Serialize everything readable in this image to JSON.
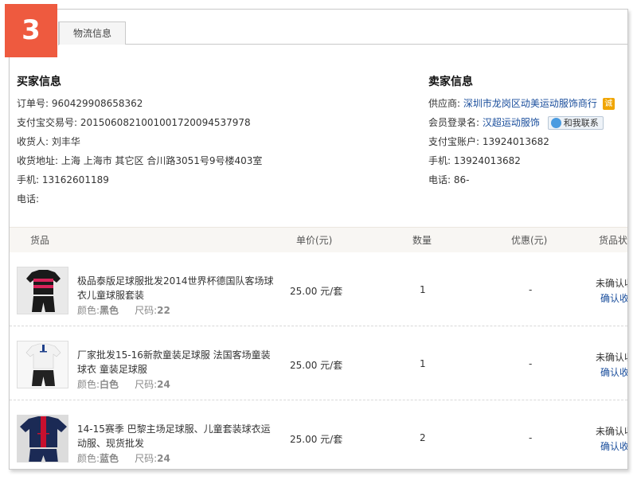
{
  "step_badge": "3",
  "tabs": [
    {
      "label": "物流信息"
    }
  ],
  "buyer": {
    "title": "买家信息",
    "rows": [
      {
        "label": "订单号:",
        "value": "960429908658362"
      },
      {
        "label": "支付宝交易号:",
        "value": "2015060821001001720094537978"
      },
      {
        "label": "收货人:",
        "value": "刘丰华"
      },
      {
        "label": "收货地址:",
        "value": "上海 上海市 其它区 合川路3051号9号楼403室"
      },
      {
        "label": "手机:",
        "value": "13162601189"
      },
      {
        "label": "电话:",
        "value": ""
      }
    ]
  },
  "seller": {
    "title": "卖家信息",
    "supplier_label": "供应商:",
    "supplier_name": "深圳市龙岗区动美运动服饰商行",
    "cheng_icon": "诚",
    "member_label": "会员登录名:",
    "member_name": "汉超运动服饰",
    "contact_button": "和我联系",
    "alipay_label": "支付宝账户:",
    "alipay_value": "13924013682",
    "mobile_label": "手机:",
    "mobile_value": "13924013682",
    "phone_label": "电话:",
    "phone_value": "86-"
  },
  "table": {
    "headers": {
      "goods": "货品",
      "price": "单价(元)",
      "qty": "数量",
      "discount": "优惠(元)",
      "status": "货品状"
    }
  },
  "items": [
    {
      "title": "极品泰版足球服批发2014世界杯德国队客场球衣儿童球服套装",
      "color_label": "颜色:",
      "color": "黑色",
      "size_label": "尺码:",
      "size": "22",
      "price": "25.00 元/套",
      "qty": "1",
      "discount": "-",
      "status": "未确认收",
      "action": "确认收",
      "shirt_color": "#1a1a1a",
      "stripe_color": "#d8235a",
      "shorts_color": "#1a1a1a"
    },
    {
      "title": "厂家批发15-16新款童装足球服 法国客场童装球衣 童装足球服",
      "color_label": "颜色:",
      "color": "白色",
      "size_label": "尺码:",
      "size": "24",
      "price": "25.00 元/套",
      "qty": "1",
      "discount": "-",
      "status": "未确认收",
      "action": "确认收",
      "shirt_color": "#f2f2f2",
      "stripe_color": "#1d3f8a",
      "shorts_color": "#222222"
    },
    {
      "title": "14-15赛季 巴黎主场足球服、儿童套装球衣运动服、现货批发",
      "color_label": "颜色:",
      "color": "蓝色",
      "size_label": "尺码:",
      "size": "24",
      "price": "25.00 元/套",
      "qty": "2",
      "discount": "-",
      "status": "未确认收",
      "action": "确认收",
      "shirt_color": "#1b2a55",
      "stripe_color": "#c8102e",
      "shorts_color": "#1b2a55"
    }
  ]
}
